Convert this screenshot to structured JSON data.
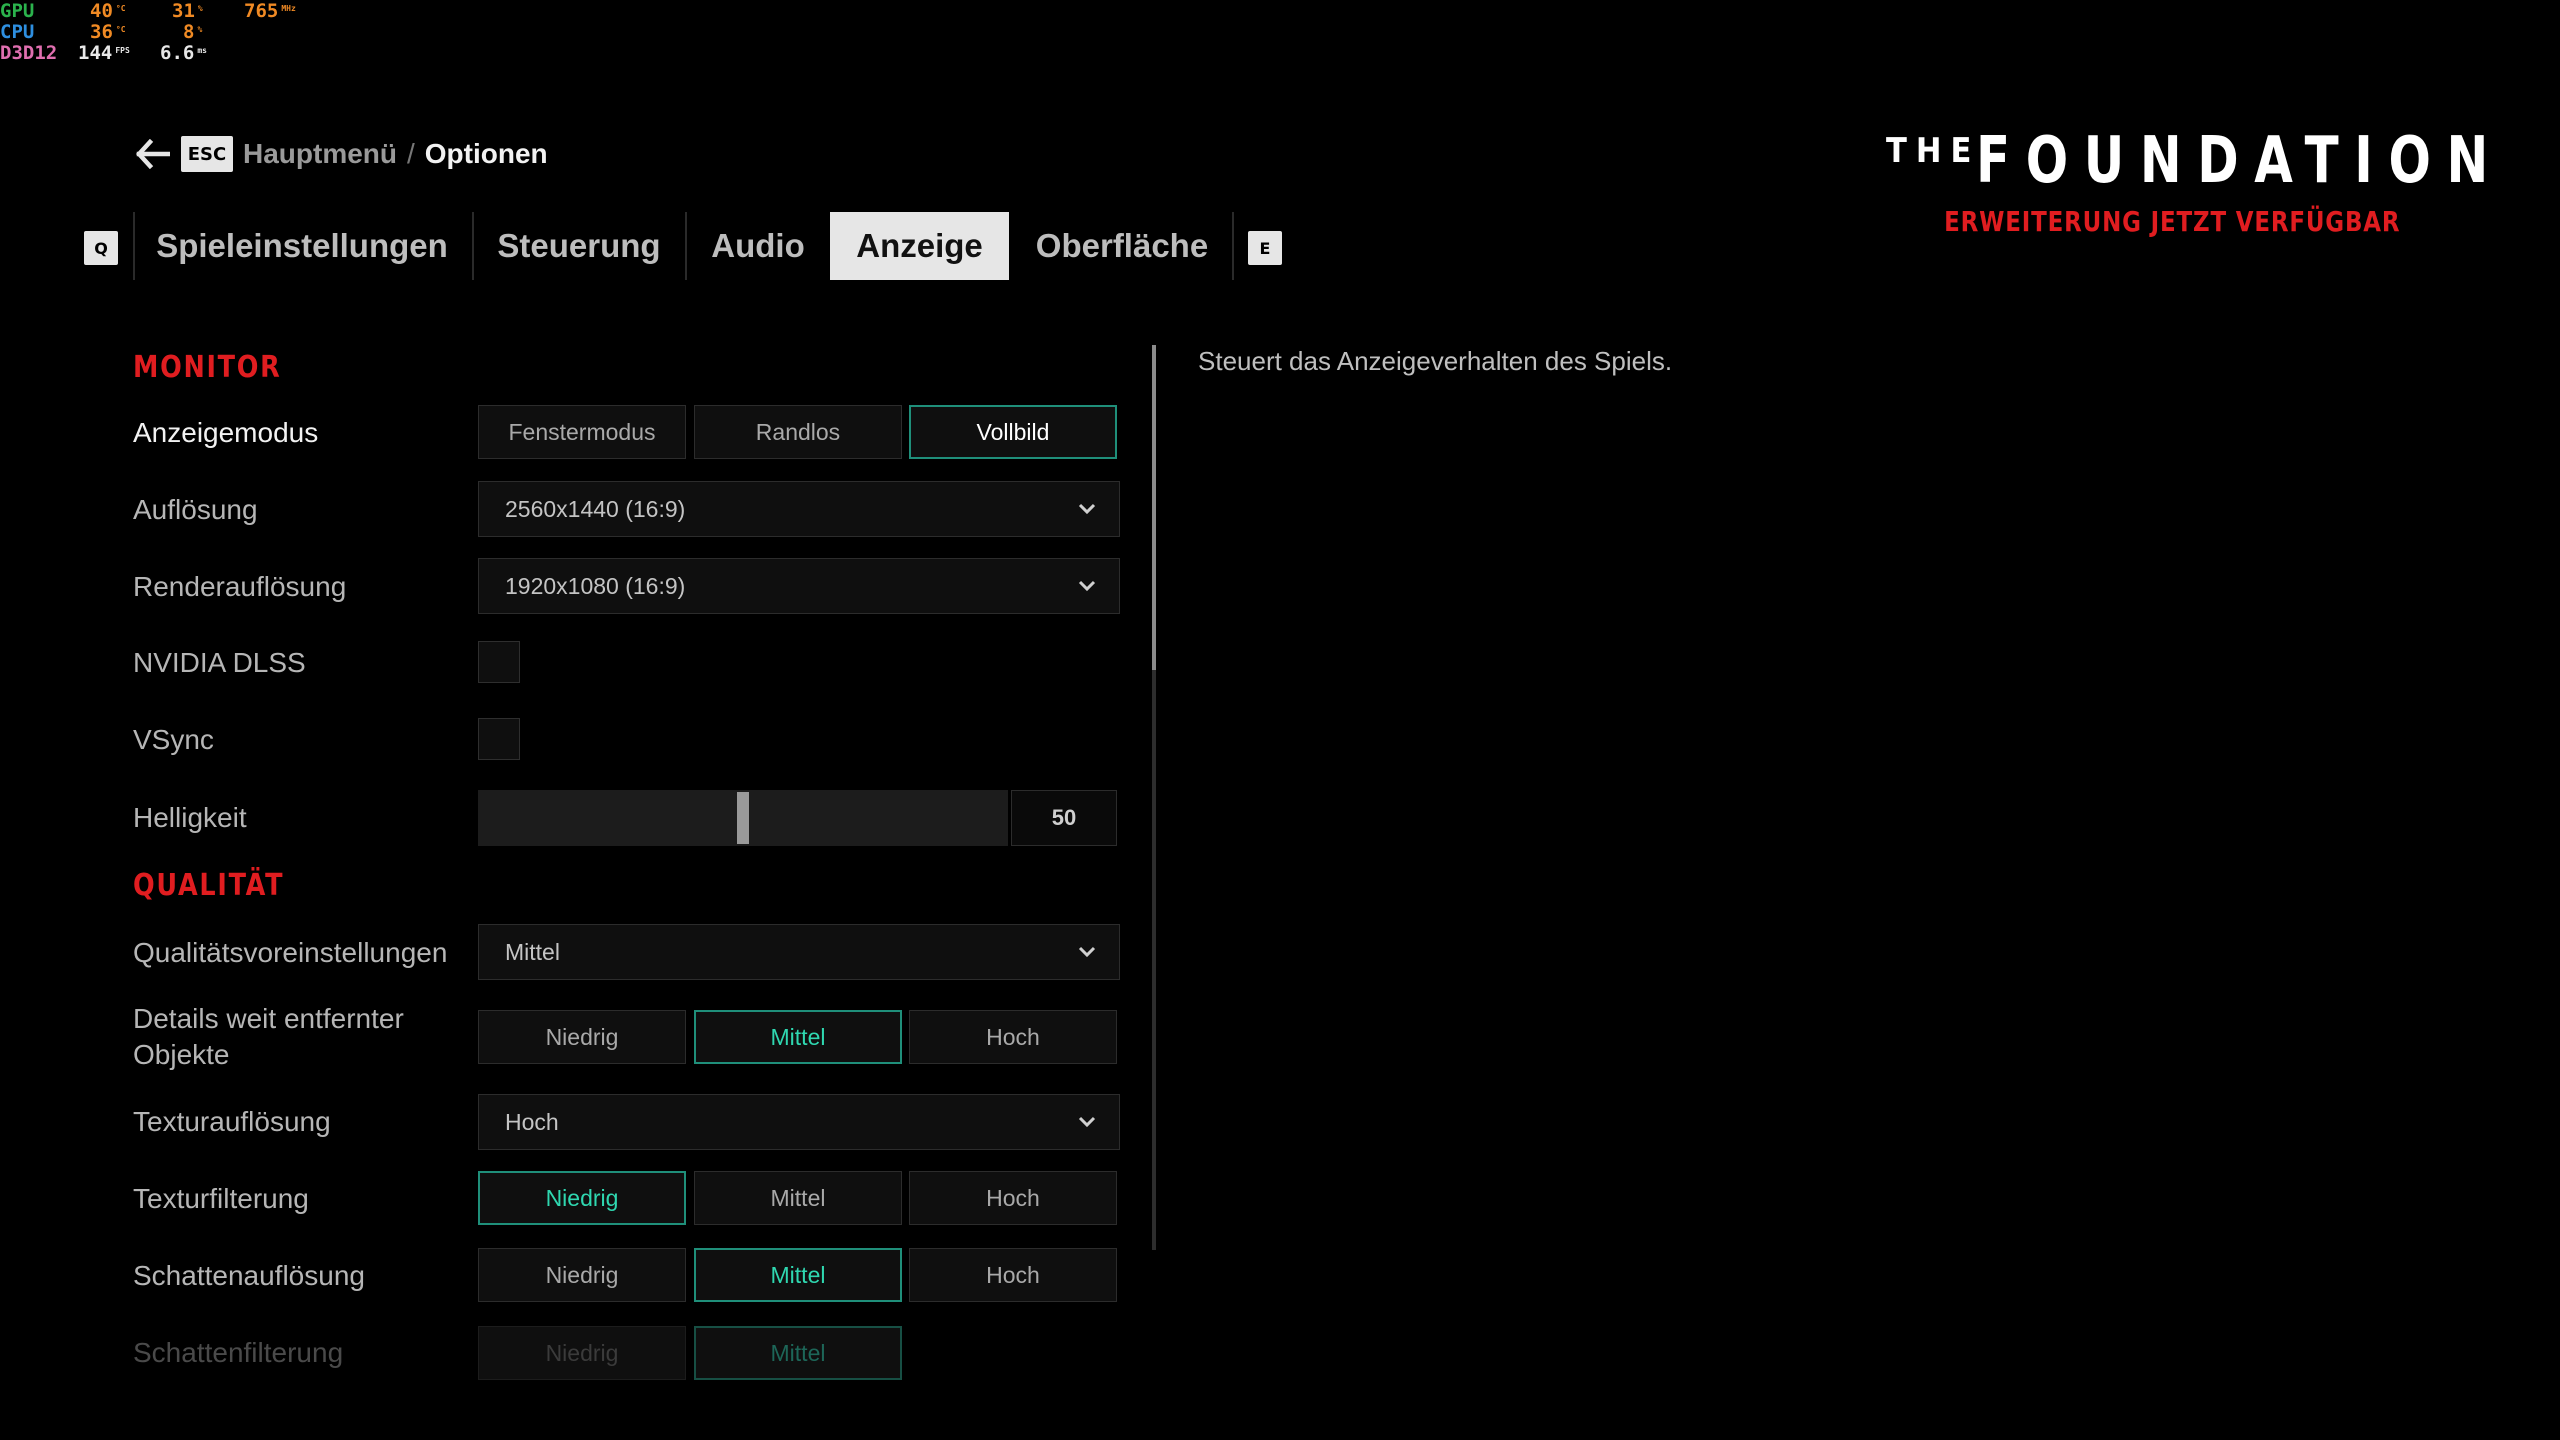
{
  "osd": {
    "gpu": {
      "label": "GPU",
      "temp": "40",
      "temp_unit": "°C",
      "load": "31",
      "load_unit": "%",
      "clock": "765",
      "clock_unit": "MHz"
    },
    "cpu": {
      "label": "CPU",
      "temp": "36",
      "temp_unit": "°C",
      "load": "8",
      "load_unit": "%"
    },
    "api": {
      "label": "D3D12",
      "fps": "144",
      "fps_unit": "FPS",
      "frametime": "6.6",
      "frametime_unit": "ms"
    }
  },
  "breadcrumb": {
    "back_key": "ESC",
    "parent": "Hauptmenü",
    "separator": "/",
    "current": "Optionen"
  },
  "tabs": {
    "prev_key": "Q",
    "next_key": "E",
    "items": [
      {
        "label": "Spieleinstellungen"
      },
      {
        "label": "Steuerung"
      },
      {
        "label": "Audio"
      },
      {
        "label": "Anzeige",
        "active": true
      },
      {
        "label": "Oberfläche"
      }
    ]
  },
  "logo": {
    "the": "THE",
    "title": "FOUNDATION",
    "subtitle": "ERWEITERUNG JETZT VERFÜGBAR",
    "accent_color": "#e01d20"
  },
  "settings": {
    "monitor": {
      "heading": "MONITOR",
      "display_mode": {
        "label": "Anzeigemodus",
        "options": [
          "Fenstermodus",
          "Randlos",
          "Vollbild"
        ],
        "selected": "Vollbild"
      },
      "resolution": {
        "label": "Auflösung",
        "value": "2560x1440 (16:9)"
      },
      "render_resolution": {
        "label": "Renderauflösung",
        "value": "1920x1080 (16:9)"
      },
      "dlss": {
        "label": "NVIDIA DLSS",
        "checked": false
      },
      "vsync": {
        "label": "VSync",
        "checked": false
      },
      "brightness": {
        "label": "Helligkeit",
        "value": "50",
        "fraction": 0.5
      }
    },
    "quality": {
      "heading": "QUALITÄT",
      "preset": {
        "label": "Qualitätsvoreinstellungen",
        "value": "Mittel"
      },
      "distant_details": {
        "label_line1": "Details weit entfernter",
        "label_line2": "Objekte",
        "options": [
          "Niedrig",
          "Mittel",
          "Hoch"
        ],
        "selected": "Mittel"
      },
      "texture_resolution": {
        "label": "Texturauflösung",
        "value": "Hoch"
      },
      "texture_filtering": {
        "label": "Texturfilterung",
        "options": [
          "Niedrig",
          "Mittel",
          "Hoch"
        ],
        "selected": "Niedrig"
      },
      "shadow_resolution": {
        "label": "Schattenauflösung",
        "options": [
          "Niedrig",
          "Mittel",
          "Hoch"
        ],
        "selected": "Mittel"
      },
      "shadow_filtering": {
        "label": "Schattenfilterung",
        "options": [
          "Niedrig",
          "Mittel"
        ],
        "selected": "Mittel"
      }
    }
  },
  "description": "Steuert das Anzeigeverhalten des Spiels.",
  "colors": {
    "accent_red": "#e01d20",
    "selection_teal": "#2fd7b0",
    "selection_border": "#1f8f7a"
  }
}
